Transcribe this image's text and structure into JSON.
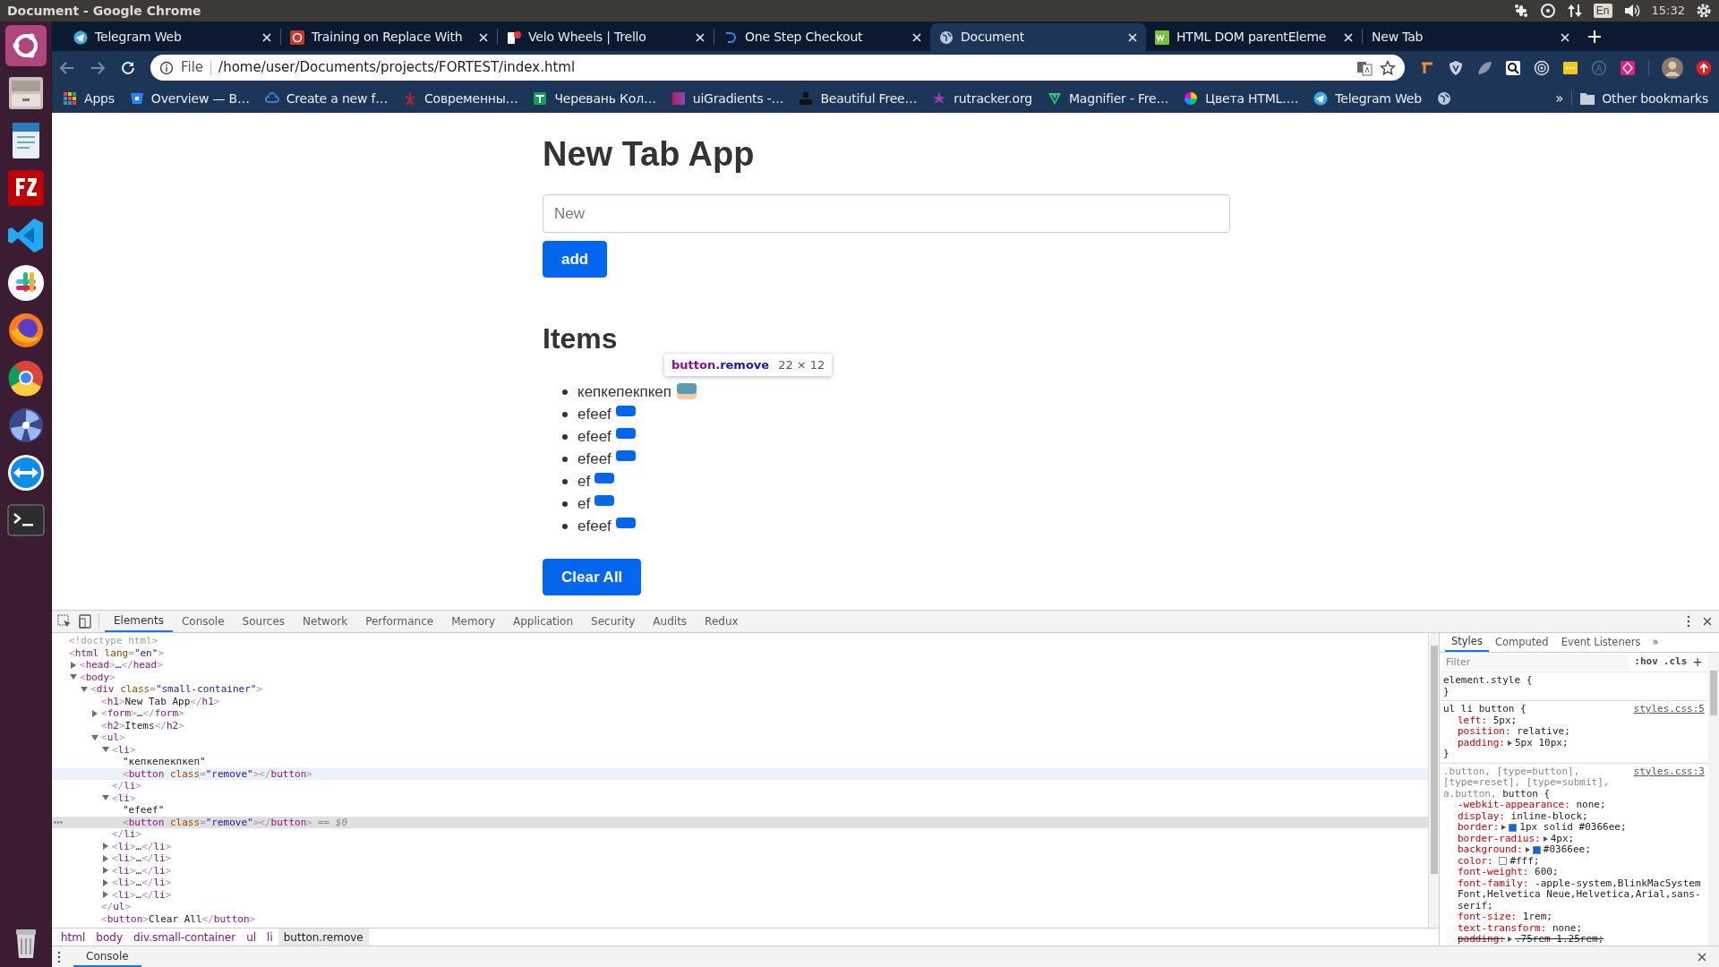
{
  "title_bar": {
    "title": "Document - Google Chrome",
    "keyboard_layout": "En",
    "clock": "15:32"
  },
  "tabs": [
    {
      "title": "Telegram Web",
      "selected": false
    },
    {
      "title": "Training on Replace With",
      "selected": false
    },
    {
      "title": "Velo Wheels | Trello",
      "selected": false
    },
    {
      "title": "One Step Checkout",
      "selected": false
    },
    {
      "title": "Document",
      "selected": true
    },
    {
      "title": "HTML DOM parentEleme",
      "selected": false
    },
    {
      "title": "New Tab",
      "selected": false
    }
  ],
  "address_bar": {
    "scheme": "File",
    "url": "/home/user/Documents/projects/FORTEST/index.html"
  },
  "bookmarks": [
    {
      "label": "Apps"
    },
    {
      "label": "Overview — B…"
    },
    {
      "label": "Create a new f…"
    },
    {
      "label": "Современны…"
    },
    {
      "label": "Черевань Кол…"
    },
    {
      "label": "uiGradients -…"
    },
    {
      "label": "Beautiful Free…"
    },
    {
      "label": "rutracker.org"
    },
    {
      "label": "Magnifier - Fre…"
    },
    {
      "label": "Цвета HTML.…"
    },
    {
      "label": "Telegram Web"
    },
    {
      "kind": "icon-only"
    }
  ],
  "bookmarks_overflow": "»",
  "other_bookmarks": "Other bookmarks",
  "page": {
    "heading": "New Tab App",
    "input_placeholder": "New",
    "add_button": "add",
    "items_heading": "Items",
    "items": [
      {
        "text": "кепкепекпкеп",
        "inspected": true
      },
      {
        "text": "efeef",
        "inspected": false
      },
      {
        "text": "efeef",
        "inspected": false
      },
      {
        "text": "efeef",
        "inspected": false
      },
      {
        "text": "ef",
        "inspected": false
      },
      {
        "text": "ef",
        "inspected": false
      },
      {
        "text": "efeef",
        "inspected": false
      }
    ],
    "clear_button": "Clear All"
  },
  "inspect_tooltip": {
    "tag": "button",
    "class": ".remove",
    "size": "22 × 12"
  },
  "devtools": {
    "tabs": [
      {
        "label": "Elements",
        "selected": true
      },
      {
        "label": "Console",
        "selected": false
      },
      {
        "label": "Sources",
        "selected": false
      },
      {
        "label": "Network",
        "selected": false
      },
      {
        "label": "Performance",
        "selected": false
      },
      {
        "label": "Memory",
        "selected": false
      },
      {
        "label": "Application",
        "selected": false
      },
      {
        "label": "Security",
        "selected": false
      },
      {
        "label": "Audits",
        "selected": false
      },
      {
        "label": "Redux",
        "selected": false
      }
    ],
    "dom_tree": [
      {
        "markup": "<!doctype html>"
      },
      {
        "markup": "<html lang=\"en\">",
        "children": [
          {
            "markup": "<head>…</head>",
            "expanded": false
          },
          {
            "markup": "<body>",
            "expanded": true,
            "children": [
              {
                "markup": "<div class=\"small-container\">",
                "expanded": true,
                "children": [
                  {
                    "markup": "<h1>New Tab App</h1>"
                  },
                  {
                    "markup": "<form>…</form>",
                    "expanded": false
                  },
                  {
                    "markup": "<h2>Items</h2>"
                  },
                  {
                    "markup": "<ul>",
                    "expanded": true,
                    "close": "</ul>",
                    "children": [
                      {
                        "markup": "<li>",
                        "expanded": true,
                        "close": "</li>",
                        "children": [
                          {
                            "markup": "\"кепкепекпкеп\""
                          },
                          {
                            "markup": "<button class=\"remove\"></button>",
                            "hovered": true
                          }
                        ]
                      },
                      {
                        "markup": "<li>",
                        "expanded": true,
                        "close": "</li>",
                        "children": [
                          {
                            "markup": "\"efeef\""
                          },
                          {
                            "markup": "<button class=\"remove\"></button>",
                            "selected": true,
                            "suffix": "== $0"
                          }
                        ]
                      },
                      {
                        "markup": "<li>…</li>",
                        "expanded": false
                      },
                      {
                        "markup": "<li>…</li>",
                        "expanded": false
                      },
                      {
                        "markup": "<li>…</li>",
                        "expanded": false
                      },
                      {
                        "markup": "<li>…</li>",
                        "expanded": false
                      },
                      {
                        "markup": "<li>…</li>",
                        "expanded": false
                      }
                    ]
                  },
                  {
                    "markup": "<button>Clear All</button>"
                  }
                ]
              }
            ]
          }
        ]
      }
    ],
    "breadcrumbs": [
      {
        "label": "html",
        "selected": false
      },
      {
        "label": "body",
        "selected": false
      },
      {
        "label": "div.small-container",
        "selected": false
      },
      {
        "label": "ul",
        "selected": false
      },
      {
        "label": "li",
        "selected": false
      },
      {
        "label": "button.remove",
        "selected": true
      }
    ],
    "styles_tabs": [
      {
        "label": "Styles",
        "selected": true
      },
      {
        "label": "Computed",
        "selected": false
      },
      {
        "label": "Event Listeners",
        "selected": false
      }
    ],
    "styles_tabs_overflow": "»",
    "filter_placeholder": "Filter",
    "hov": ":hov",
    "cls": ".cls",
    "add_rule": "+",
    "rules": [
      {
        "selector": "element.style {",
        "close": "}"
      },
      {
        "selector": "ul li button {",
        "source": "styles.css:5",
        "close": "}",
        "declarations": [
          {
            "prop": "left:",
            "value": "5px;"
          },
          {
            "prop": "position:",
            "value": "relative;"
          },
          {
            "prop": "padding:",
            "value": "5px 10px;",
            "expandable": true
          }
        ]
      },
      {
        "selector_unmatched": ".button, [type=button], [type=reset], [type=submit], a.button,",
        "selector": "button {",
        "source": "styles.css:3",
        "declarations": [
          {
            "prop": "-webkit-appearance:",
            "value": "none;"
          },
          {
            "prop": "display:",
            "value": "inline-block;"
          },
          {
            "prop": "border:",
            "value": "1px solid #0366ee;",
            "expandable": true,
            "swatch": true
          },
          {
            "prop": "border-radius:",
            "value": "4px;",
            "expandable": true
          },
          {
            "prop": "background:",
            "value": "#0366ee;",
            "expandable": true,
            "swatch": true
          },
          {
            "prop": "color:",
            "value": "#fff;",
            "swatch": true
          },
          {
            "prop": "font-weight:",
            "value": "600;"
          },
          {
            "prop": "font-family:",
            "value": "-apple-system,BlinkMacSystemFont,Helvetica Neue,Helvetica,Arial,sans-serif;"
          },
          {
            "prop": "font-size:",
            "value": "1rem;"
          },
          {
            "prop": "text-transform:",
            "value": "none;"
          },
          {
            "prop": "padding:",
            "value": ".75rem 1.25rem;",
            "expandable": true,
            "struck": true
          }
        ]
      }
    ],
    "drawer_tab": "Console"
  }
}
